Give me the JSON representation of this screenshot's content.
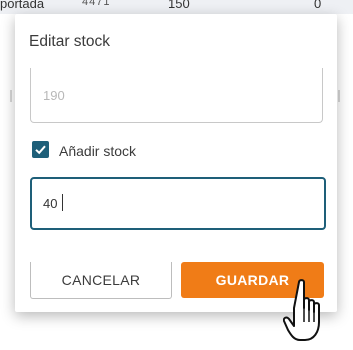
{
  "background_table": {
    "row_cells": [
      "portada",
      "4471",
      "150",
      "0"
    ]
  },
  "dialog": {
    "title": "Editar stock",
    "stock_value": "190",
    "checkbox_label": "Añadir stock",
    "checkbox_checked": true,
    "amount_value": "40",
    "cancel_label": "CANCELAR",
    "save_label": "GUARDAR"
  },
  "colors": {
    "primary": "#1e5f79",
    "accent": "#f07c17"
  },
  "icons": {
    "checkbox": "check-icon",
    "pointer": "hand-pointer-icon"
  }
}
